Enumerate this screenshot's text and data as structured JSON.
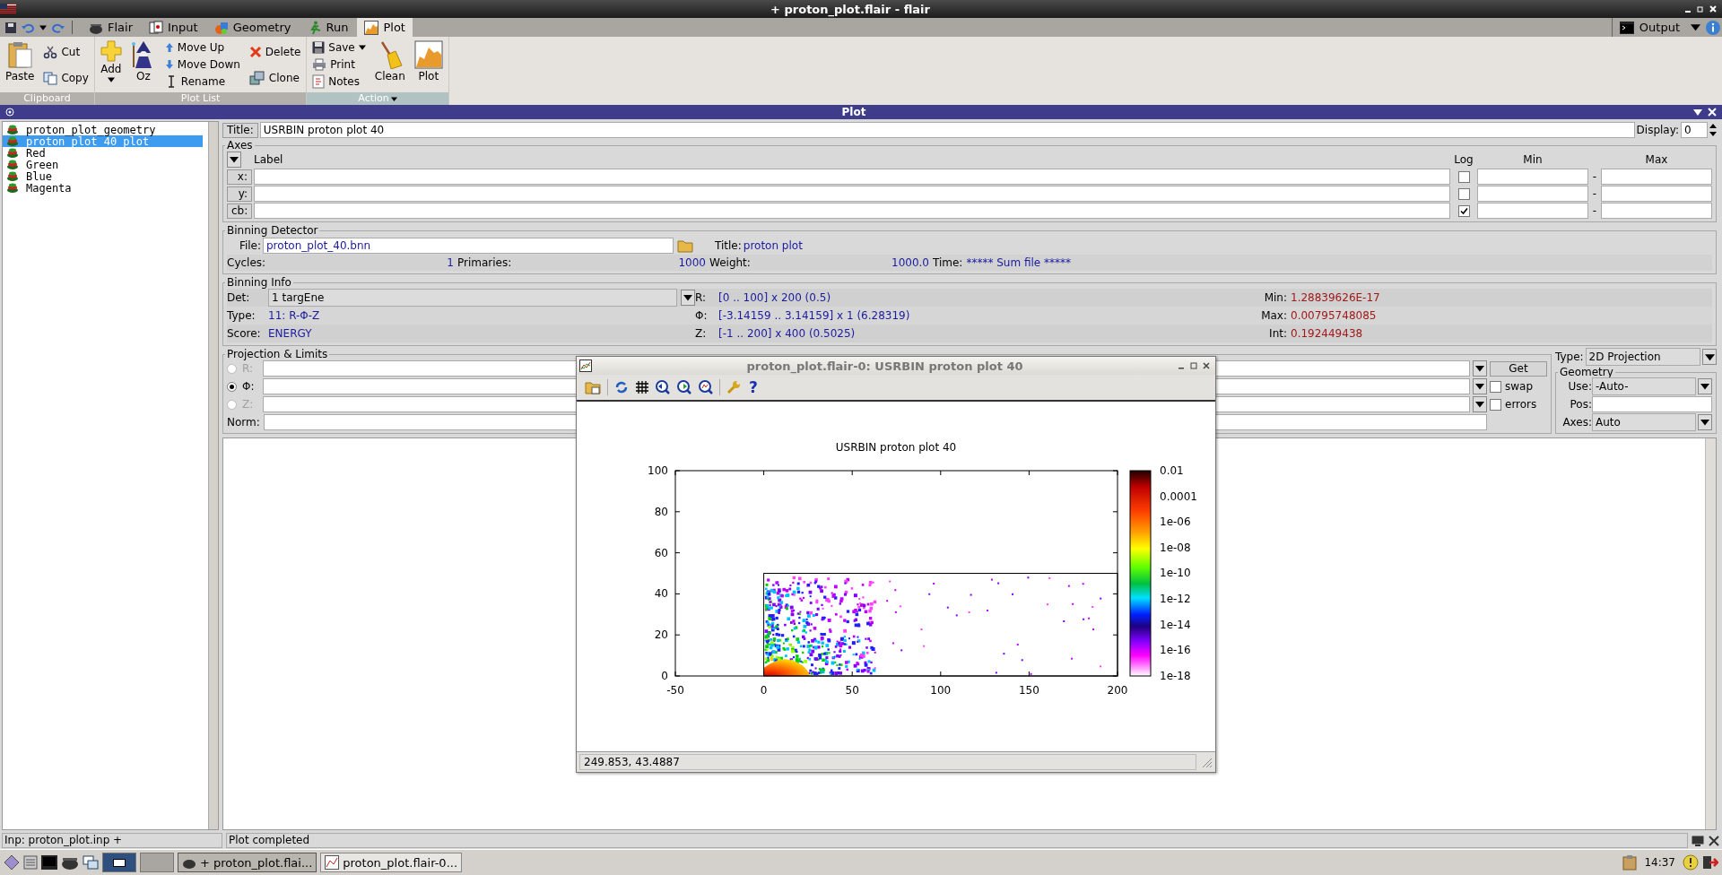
{
  "window": {
    "title": "+ proton_plot.flair - flair"
  },
  "menu_tabs": [
    {
      "label": "Flair",
      "selected": false
    },
    {
      "label": "Input",
      "selected": false
    },
    {
      "label": "Geometry",
      "selected": false
    },
    {
      "label": "Run",
      "selected": false
    },
    {
      "label": "Plot",
      "selected": true
    }
  ],
  "output_menu": {
    "label": "Output"
  },
  "ribbon": [
    {
      "label": "Clipboard",
      "active": false,
      "columns": [
        {
          "kind": "large",
          "items": [
            {
              "label": "Paste",
              "dropdown": false
            }
          ]
        },
        {
          "kind": "small",
          "items": [
            {
              "label": "Cut",
              "dropdown": false
            },
            {
              "label": "Copy",
              "dropdown": false
            }
          ]
        }
      ]
    },
    {
      "label": "Plot List",
      "active": false,
      "columns": [
        {
          "kind": "large",
          "items": [
            {
              "label": "Add",
              "dropdown": true
            }
          ]
        },
        {
          "kind": "large",
          "items": [
            {
              "label": "Oz",
              "dropdown": false
            }
          ]
        },
        {
          "kind": "small",
          "items": [
            {
              "label": "Move Up",
              "dropdown": false
            },
            {
              "label": "Move Down",
              "dropdown": false
            },
            {
              "label": "Rename",
              "dropdown": false
            }
          ]
        },
        {
          "kind": "small",
          "items": [
            {
              "label": "Delete",
              "dropdown": false
            },
            {
              "label": "Clone",
              "dropdown": false
            }
          ]
        }
      ]
    },
    {
      "label": "Action",
      "active": true,
      "columns": [
        {
          "kind": "small",
          "items": [
            {
              "label": "Save",
              "dropdown": true
            },
            {
              "label": "Print",
              "dropdown": false
            },
            {
              "label": "Notes",
              "dropdown": false
            }
          ]
        },
        {
          "kind": "large",
          "items": [
            {
              "label": "Clean",
              "dropdown": false
            }
          ]
        },
        {
          "kind": "large",
          "items": [
            {
              "label": "Plot",
              "dropdown": false
            }
          ]
        }
      ]
    }
  ],
  "panel": {
    "title": "Plot"
  },
  "plot_list": [
    {
      "label": "proton_plot_geometry",
      "selected": false
    },
    {
      "label": "proton_plot_40_plot",
      "selected": true
    },
    {
      "label": "Red",
      "selected": false
    },
    {
      "label": "Green",
      "selected": false
    },
    {
      "label": "Blue",
      "selected": false
    },
    {
      "label": "Magenta",
      "selected": false
    }
  ],
  "title_field": {
    "label": "Title:",
    "value": "USRBIN proton plot 40"
  },
  "display": {
    "label": "Display:",
    "value": "0"
  },
  "axes": {
    "legend": "Axes",
    "columns": [
      "Label",
      "Log",
      "Min",
      "Max"
    ],
    "rows": [
      {
        "label": "x:",
        "log": false,
        "separator": "-"
      },
      {
        "label": "y:",
        "log": false,
        "separator": "-"
      },
      {
        "label": "cb:",
        "log": true,
        "separator": "-"
      }
    ]
  },
  "binning_detector": {
    "legend": "Binning Detector",
    "file_label": "File:",
    "file": "proton_plot_40.bnn",
    "title_label": "Title:",
    "title": "proton plot",
    "stats": [
      {
        "kind": "number",
        "label": "Cycles:",
        "value": "1"
      },
      {
        "kind": "number",
        "label": "Primaries:",
        "value": "1000"
      },
      {
        "kind": "number",
        "label": "Weight:",
        "value": "1000.0"
      },
      {
        "kind": "text",
        "label": "Time:",
        "value": "***** Sum file *****"
      }
    ]
  },
  "binning_info": {
    "legend": "Binning Info",
    "rows": [
      {
        "cells": [
          {
            "kind": "select",
            "label": "Det:",
            "value": "1 targEne"
          },
          {
            "kind": "info",
            "label": "R:",
            "value": "[0 .. 100] x 200 (0.5)"
          },
          {
            "kind": "result",
            "label": "Min:",
            "value": "1.28839626E-17"
          }
        ]
      },
      {
        "cells": [
          {
            "kind": "info",
            "label": "Type:",
            "value": "11: R-Φ-Z"
          },
          {
            "kind": "info",
            "label": "Φ:",
            "value": "[-3.14159 .. 3.14159] x 1 (6.28319)"
          },
          {
            "kind": "result",
            "label": "Max:",
            "value": "0.00795748085"
          }
        ]
      },
      {
        "cells": [
          {
            "kind": "info",
            "label": "Score:",
            "value": "ENERGY"
          },
          {
            "kind": "info",
            "label": "Z:",
            "value": "[-1 .. 200] x 400 (0.5025)"
          },
          {
            "kind": "result",
            "label": "Int:",
            "value": "0.192449438"
          }
        ]
      }
    ]
  },
  "projection": {
    "legend": "Projection & Limits",
    "rows": [
      {
        "label": "R:",
        "selected": false,
        "disabled": true
      },
      {
        "label": "Φ:",
        "selected": true,
        "disabled": false
      },
      {
        "label": "Z:",
        "selected": false,
        "disabled": true
      }
    ],
    "norm_label": "Norm:",
    "get_button": "Get",
    "options": [
      {
        "label": "swap",
        "checked": false
      },
      {
        "label": "errors",
        "checked": false
      }
    ]
  },
  "type_select": {
    "label": "Type:",
    "value": "2D Projection"
  },
  "geometry": {
    "legend": "Geometry",
    "rows": [
      {
        "kind": "select",
        "label": "Use:",
        "value": "-Auto-"
      },
      {
        "kind": "input",
        "label": "Pos:"
      },
      {
        "kind": "select",
        "label": "Axes:",
        "value": "Auto"
      }
    ]
  },
  "plot_window": {
    "title": "proton_plot.flair-0: USRBIN proton plot 40",
    "help_label": "?",
    "chart_title": "USRBIN proton plot 40",
    "y_ticks": [
      "100",
      "80",
      "60",
      "40",
      "20",
      "0"
    ],
    "x_ticks": [
      "-50",
      "0",
      "50",
      "100",
      "150",
      "200"
    ],
    "colorbar_ticks": [
      "0.01",
      "0.0001",
      "1e-06",
      "1e-08",
      "1e-10",
      "1e-12",
      "1e-14",
      "1e-16",
      "1e-18"
    ],
    "coordinates": "249.853,  43.4887"
  },
  "status_bar": {
    "input": "Inp: proton_plot.inp +",
    "message": "Plot completed"
  },
  "taskbar": {
    "workspaces": [
      {
        "selected": true
      },
      {
        "selected": false
      }
    ],
    "tasks": [
      {
        "label": "+ proton_plot.flai...",
        "selected": true
      },
      {
        "label": "proton_plot.flair-0...",
        "selected": false
      }
    ],
    "clock": "14:37"
  }
}
